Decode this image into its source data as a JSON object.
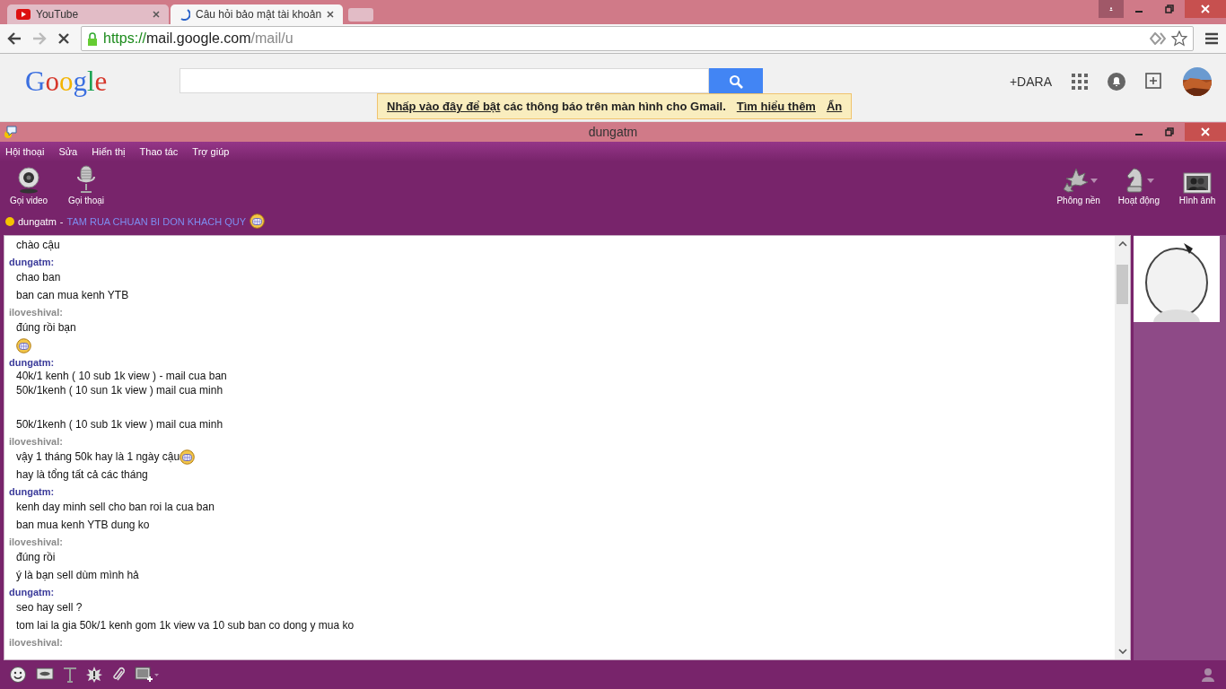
{
  "browser": {
    "tabs": [
      {
        "title": "YouTube",
        "kind": "youtube",
        "selected": false
      },
      {
        "title": "Câu hỏi bảo mật tài khoản",
        "kind": "loading",
        "selected": true
      }
    ],
    "address": {
      "scheme": "https://",
      "host": "mail.google.com",
      "path": "/mail/u"
    }
  },
  "gmail": {
    "logo": "Google",
    "account": "+DARA",
    "notice": {
      "link": "Nhấp vào đây để bật",
      "text": " các thông báo trên màn hình cho Gmail.",
      "learn_more": "Tìm hiểu thêm",
      "hide": "Ẩn"
    }
  },
  "messenger": {
    "title": "dungatm",
    "menu": [
      "Hội thoại",
      "Sửa",
      "Hiển thị",
      "Thao tác",
      "Trợ giúp"
    ],
    "left_tools": [
      {
        "label": "Gọi video",
        "kind": "webcam"
      },
      {
        "label": "Gọi thoại",
        "kind": "mic"
      }
    ],
    "right_tools": [
      {
        "label": "Phông nền",
        "kind": "leaves",
        "dropdown": true
      },
      {
        "label": "Hoạt động",
        "kind": "knight",
        "dropdown": true
      },
      {
        "label": "Hình ảnh",
        "kind": "photos",
        "dropdown": false
      }
    ],
    "contact": {
      "name": "dungatm",
      "separator": "-",
      "status": "TAM RUA CHUAN BI DON KHACH QUY"
    },
    "chat": [
      {
        "lines": [
          {
            "text": "chào cậu"
          }
        ]
      },
      {
        "sender": "dungatm:",
        "kind": "self",
        "lines": [
          {
            "text": "chao ban"
          },
          {
            "text": "ban can mua kenh YTB"
          }
        ]
      },
      {
        "sender": "iloveshival:",
        "kind": "other",
        "lines": [
          {
            "text": "đúng rồi bạn"
          },
          {
            "kind": "emoticon"
          }
        ]
      },
      {
        "sender": "dungatm:",
        "kind": "self",
        "lines": [
          {
            "text": "40k/1 kenh ( 10 sub 1k view ) - mail cua ban",
            "tight": true
          },
          {
            "text": "50k/1kenh ( 10 sun 1k view ) mail cua minh",
            "tight": true
          },
          {
            "text": "50k/1kenh ( 10 sub 1k view ) mail cua minh",
            "gap_before": true
          }
        ]
      },
      {
        "sender": "iloveshival:",
        "kind": "other",
        "lines": [
          {
            "text": "vậy 1 tháng 50k hay là 1 ngày cậu",
            "emoticon_after": true
          },
          {
            "text": "hay là tổng tất cả các tháng"
          }
        ]
      },
      {
        "sender": "dungatm:",
        "kind": "self",
        "lines": [
          {
            "text": "kenh day minh sell cho ban roi la cua ban"
          },
          {
            "text": "ban mua kenh YTB dung ko"
          }
        ]
      },
      {
        "sender": "iloveshival:",
        "kind": "other",
        "lines": [
          {
            "text": "đúng rồi"
          },
          {
            "text": "ý là bạn sell dùm mình hả"
          }
        ]
      },
      {
        "sender": "dungatm:",
        "kind": "self",
        "lines": [
          {
            "text": "seo hay sell ?"
          },
          {
            "text": "tom lai la gia 50k/1 kenh gom 1k view va 10 sub ban co dong y mua ko"
          }
        ]
      },
      {
        "sender": "iloveshival:",
        "kind": "other"
      }
    ]
  }
}
